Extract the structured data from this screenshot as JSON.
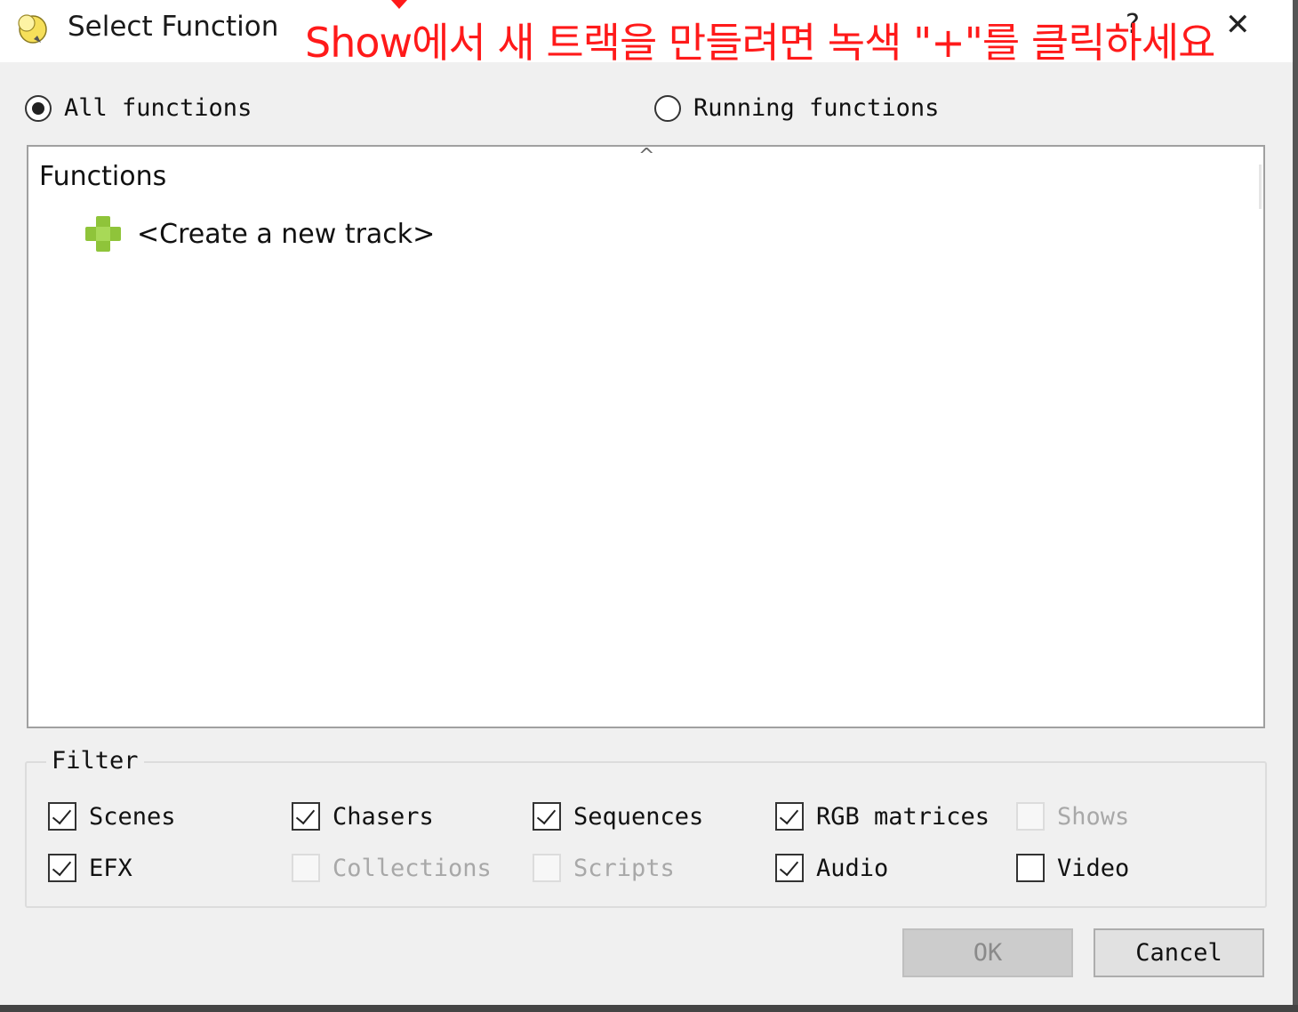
{
  "window": {
    "title": "Select Function",
    "help_glyph": "?",
    "close_glyph": "✕",
    "annotation": "Show에서 새 트랙을 만들려면 녹색 \"+\"를 클릭하세요"
  },
  "scope": {
    "options": [
      {
        "label": "All functions",
        "selected": true
      },
      {
        "label": "Running functions",
        "selected": false
      }
    ]
  },
  "tree": {
    "header": "Functions",
    "items": [
      {
        "label": "<Create a new track>",
        "icon": "green-plus-icon"
      }
    ]
  },
  "filter": {
    "title": "Filter",
    "items": [
      {
        "label": "Scenes",
        "checked": true,
        "enabled": true
      },
      {
        "label": "Chasers",
        "checked": true,
        "enabled": true
      },
      {
        "label": "Sequences",
        "checked": true,
        "enabled": true
      },
      {
        "label": "RGB matrices",
        "checked": true,
        "enabled": true
      },
      {
        "label": "Shows",
        "checked": false,
        "enabled": false
      },
      {
        "label": "EFX",
        "checked": true,
        "enabled": true
      },
      {
        "label": "Collections",
        "checked": false,
        "enabled": false
      },
      {
        "label": "Scripts",
        "checked": false,
        "enabled": false
      },
      {
        "label": "Audio",
        "checked": true,
        "enabled": true
      },
      {
        "label": "Video",
        "checked": false,
        "enabled": true
      }
    ]
  },
  "buttons": {
    "ok": "OK",
    "ok_enabled": false,
    "cancel": "Cancel"
  },
  "colors": {
    "annotation": "#ff1a1a",
    "plus_icon": "#8fc43a"
  }
}
